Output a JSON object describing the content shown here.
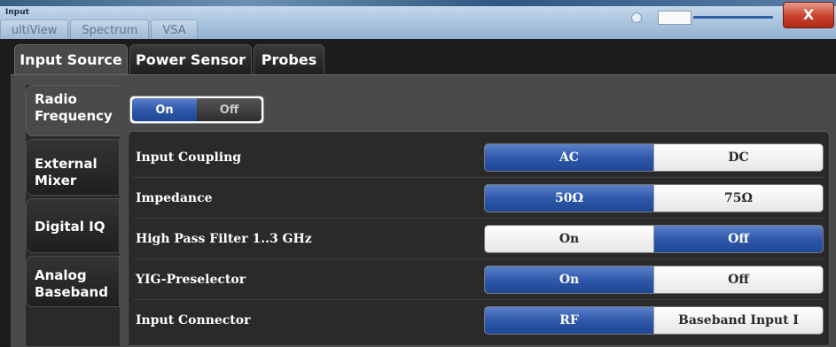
{
  "window": {
    "title": "Input",
    "background_tabs": [
      "ultiView",
      "Spectrum",
      "VSA"
    ],
    "close_label": "X"
  },
  "main_tabs": [
    {
      "label": "Input Source",
      "active": true
    },
    {
      "label": "Power Sensor",
      "active": false
    },
    {
      "label": "Probes",
      "active": false
    }
  ],
  "side_tabs": [
    {
      "label_1": "Radio",
      "label_2": "Frequency",
      "active": true
    },
    {
      "label_1": "External",
      "label_2": "Mixer",
      "active": false
    },
    {
      "label_1": "Digital IQ",
      "label_2": "",
      "active": false
    },
    {
      "label_1": "Analog",
      "label_2": "Baseband",
      "active": false
    }
  ],
  "rf_state": {
    "on": "On",
    "off": "Off",
    "selected": "On"
  },
  "settings": [
    {
      "label": "Input Coupling",
      "options": [
        "AC",
        "DC"
      ],
      "selected": 0
    },
    {
      "label": "Impedance",
      "options": [
        "50Ω",
        "75Ω"
      ],
      "selected": 0
    },
    {
      "label": "High Pass Filter 1..3 GHz",
      "options": [
        "On",
        "Off"
      ],
      "selected": 1
    },
    {
      "label": "YIG-Preselector",
      "options": [
        "On",
        "Off"
      ],
      "selected": 0
    },
    {
      "label": "Input Connector",
      "options": [
        "RF",
        "Baseband Input I"
      ],
      "selected": 0
    }
  ],
  "colors": {
    "accent": "#2c56a8",
    "panel": "#4a4a4a",
    "background": "#1c1c1c"
  }
}
